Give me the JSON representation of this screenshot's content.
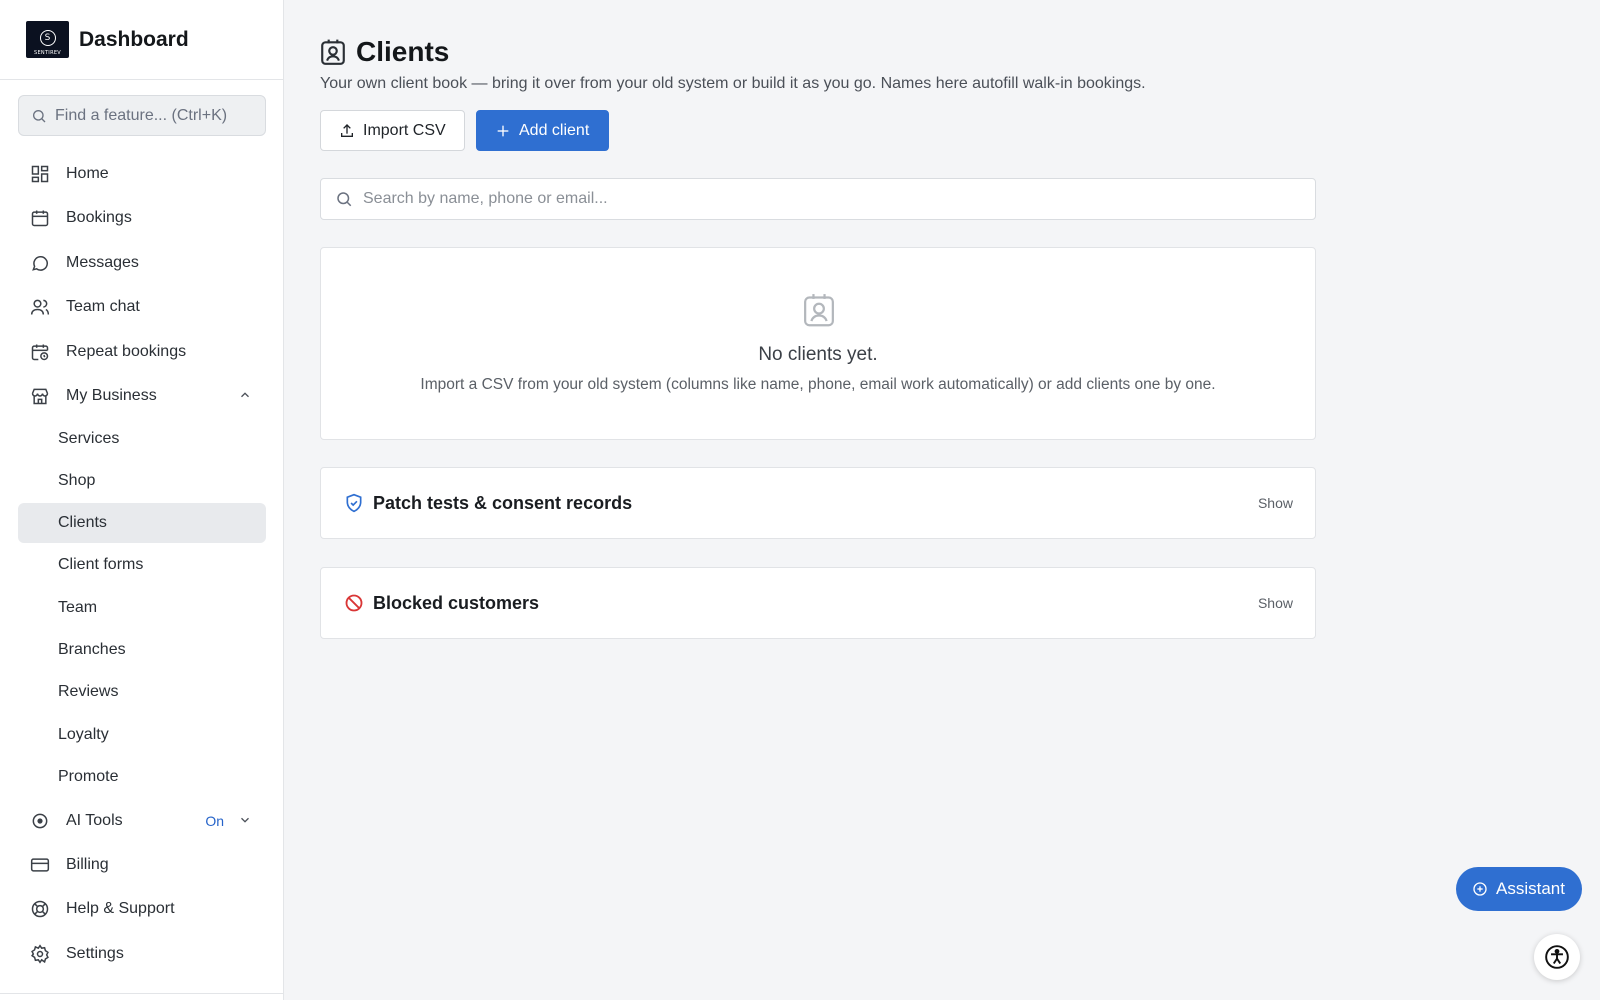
{
  "brand": {
    "title": "Dashboard",
    "logo_letter": "S",
    "logo_word": "SENTIREV"
  },
  "sidebar": {
    "find_placeholder": "Find a feature...  (Ctrl+K)",
    "items": [
      {
        "label": "Home",
        "icon": "grid-icon"
      },
      {
        "label": "Bookings",
        "icon": "calendar-icon"
      },
      {
        "label": "Messages",
        "icon": "chat-bubble-icon"
      },
      {
        "label": "Team chat",
        "icon": "users-icon"
      },
      {
        "label": "Repeat bookings",
        "icon": "calendar-clock-icon"
      },
      {
        "label": "My Business",
        "icon": "store-icon",
        "expanded": true
      }
    ],
    "business_items": [
      {
        "label": "Services"
      },
      {
        "label": "Shop"
      },
      {
        "label": "Clients",
        "active": true
      },
      {
        "label": "Client forms"
      },
      {
        "label": "Team"
      },
      {
        "label": "Branches"
      },
      {
        "label": "Reviews"
      },
      {
        "label": "Loyalty"
      },
      {
        "label": "Promote"
      }
    ],
    "bottom_items": [
      {
        "label": "AI Tools",
        "icon": "ai-icon",
        "badge": "On"
      },
      {
        "label": "Billing",
        "icon": "card-icon"
      },
      {
        "label": "Help & Support",
        "icon": "lifebuoy-icon"
      },
      {
        "label": "Settings",
        "icon": "gear-icon"
      }
    ]
  },
  "main": {
    "title": "Clients",
    "subtitle": "Your own client book — bring it over from your old system or build it as you go. Names here autofill walk-in bookings.",
    "import_label": "Import CSV",
    "add_label": "Add client",
    "search_placeholder": "Search by name, phone or email...",
    "empty_title": "No clients yet.",
    "empty_desc": "Import a CSV from your old system (columns like name, phone, email work automatically) or add clients one by one.",
    "sections": [
      {
        "title": "Patch tests & consent records",
        "action": "Show",
        "icon": "shield-check-icon"
      },
      {
        "title": "Blocked customers",
        "action": "Show",
        "icon": "blocked-icon"
      }
    ]
  },
  "assistant_label": "Assistant",
  "colors": {
    "accent": "#2f6fd1",
    "blocked": "#d93636",
    "active_bg": "#e8eaed"
  }
}
